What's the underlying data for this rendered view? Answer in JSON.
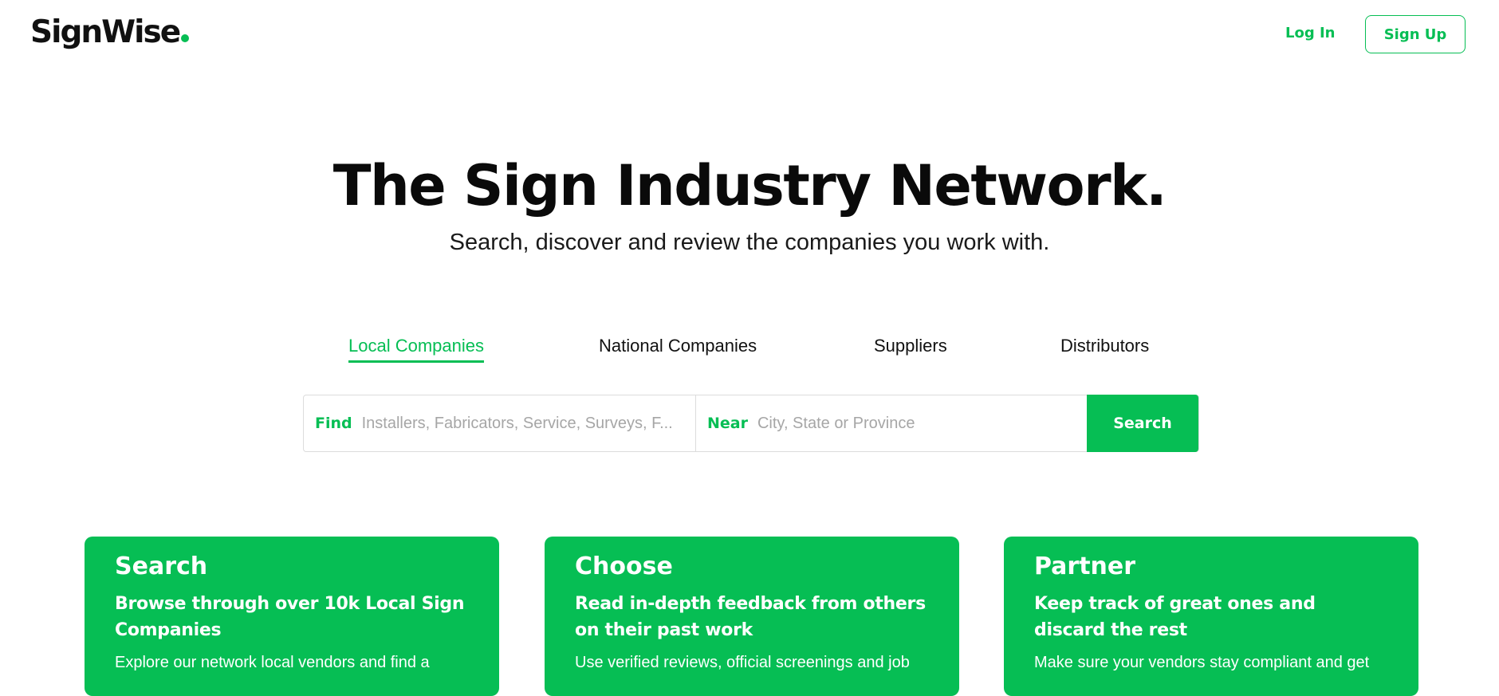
{
  "header": {
    "logo_text": "SignWise",
    "login_label": "Log In",
    "signup_label": "Sign Up"
  },
  "hero": {
    "title": "The Sign Industry Network.",
    "subtitle": "Search, discover and review the companies you work with."
  },
  "tabs": [
    {
      "label": "Local Companies",
      "active": true
    },
    {
      "label": "National Companies",
      "active": false
    },
    {
      "label": "Suppliers",
      "active": false
    },
    {
      "label": "Distributors",
      "active": false
    }
  ],
  "search": {
    "find_label": "Find",
    "find_placeholder": "Installers, Fabricators, Service, Surveys, F...",
    "near_label": "Near",
    "near_placeholder": "City, State or Province",
    "button_label": "Search"
  },
  "cards": [
    {
      "title": "Search",
      "subtitle": "Browse through over 10k Local Sign Companies",
      "body": "Explore our network local vendors and find a"
    },
    {
      "title": "Choose",
      "subtitle": "Read in-depth feedback from others on their past work",
      "body": "Use verified reviews, official screenings and job"
    },
    {
      "title": "Partner",
      "subtitle": "Keep track of great ones and discard the rest",
      "body": "Make sure your vendors stay compliant and get"
    }
  ],
  "colors": {
    "accent": "#06be54",
    "text": "#111111",
    "background": "#ffffff"
  }
}
